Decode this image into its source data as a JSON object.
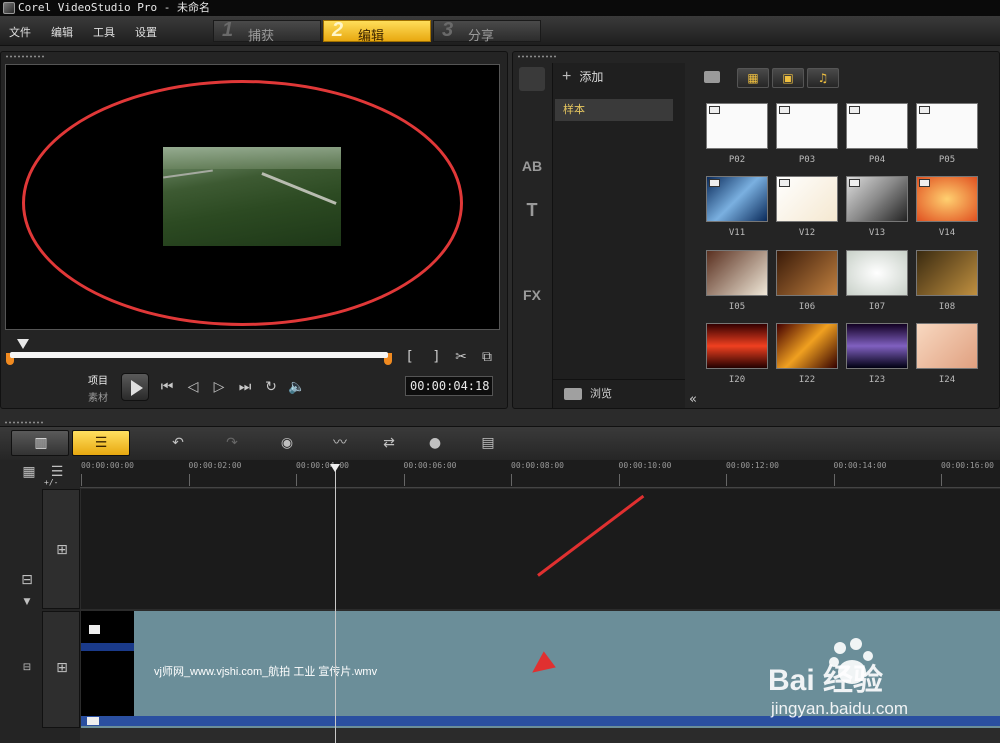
{
  "window": {
    "title": "Corel VideoStudio Pro - 未命名"
  },
  "menu": {
    "items": [
      "文件",
      "编辑",
      "工具",
      "设置"
    ]
  },
  "steps": [
    {
      "num": "1",
      "label": "捕获"
    },
    {
      "num": "2",
      "label": "编辑"
    },
    {
      "num": "3",
      "label": "分享"
    }
  ],
  "preview": {
    "mode_project": "项目",
    "mode_clip": "素材",
    "timecode": "00:00:04:18",
    "trim_in": "[",
    "trim_out": "]"
  },
  "library": {
    "add_label": "添加",
    "folder": "样本",
    "browse_label": "浏览",
    "side_icons": [
      "media-icon",
      "transition-icon",
      "title-ab-icon",
      "text-icon",
      "graphic-icon",
      "fx-icon",
      "path-icon"
    ],
    "side_glyphs": [
      "",
      "",
      "AB",
      "T",
      "",
      "FX",
      ""
    ],
    "thumbnails": [
      [
        "P02",
        "P03",
        "P04",
        "P05"
      ],
      [
        "V11",
        "V12",
        "V13",
        "V14"
      ],
      [
        "I05",
        "I06",
        "I07",
        "I08"
      ],
      [
        "I20",
        "I22",
        "I23",
        "I24"
      ]
    ]
  },
  "timeline": {
    "ruler": [
      "00:00:00:00",
      "00:00:02:00",
      "00:00:04:00",
      "00:00:06:00",
      "00:00:08:00",
      "00:00:10:00",
      "00:00:12:00",
      "00:00:14:00",
      "00:00:16:00"
    ],
    "clip_label": "vj师网_www.vjshi.com_航拍 工业 宣传片.wmv",
    "track_toggle": "+/-"
  },
  "watermark": {
    "main": "Bai  经验",
    "sub": "jingyan.baidu.com"
  },
  "colors": {
    "accent": "#f0b820",
    "clip": "#6b8e99",
    "annotation": "#e03030"
  }
}
